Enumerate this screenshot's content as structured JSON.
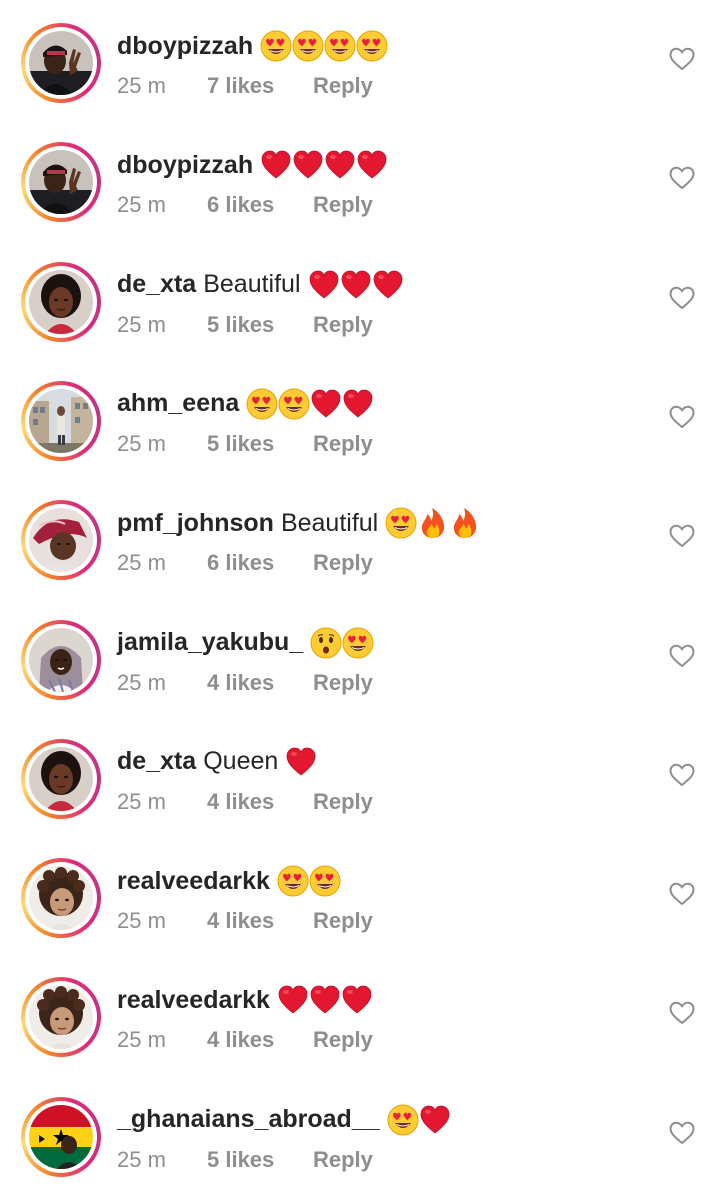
{
  "comments": [
    {
      "username": "dboypizzah",
      "text": "",
      "emojis": [
        "heart-eyes-emoji",
        "heart-eyes-emoji",
        "heart-eyes-emoji",
        "heart-eyes-emoji"
      ],
      "time": "25 m",
      "likes": "7 likes",
      "reply": "Reply",
      "avatar": "man-peace-sign"
    },
    {
      "username": "dboypizzah",
      "text": "",
      "emojis": [
        "red-heart-emoji",
        "red-heart-emoji",
        "red-heart-emoji",
        "red-heart-emoji"
      ],
      "time": "25 m",
      "likes": "6 likes",
      "reply": "Reply",
      "avatar": "man-peace-sign"
    },
    {
      "username": "de_xta",
      "text": "Beautiful",
      "emojis": [
        "red-heart-emoji",
        "red-heart-emoji",
        "red-heart-emoji"
      ],
      "time": "25 m",
      "likes": "5 likes",
      "reply": "Reply",
      "avatar": "woman-portrait"
    },
    {
      "username": "ahm_eena",
      "text": "",
      "emojis": [
        "heart-eyes-emoji",
        "heart-eyes-emoji",
        "red-heart-emoji",
        "red-heart-emoji"
      ],
      "time": "25 m",
      "likes": "5 likes",
      "reply": "Reply",
      "avatar": "building-scene"
    },
    {
      "username": "pmf_johnson",
      "text": "Beautiful",
      "emojis": [
        "heart-eyes-emoji",
        "fire-emoji",
        "fire-emoji"
      ],
      "time": "25 m",
      "likes": "6 likes",
      "reply": "Reply",
      "avatar": "person-red-scarf"
    },
    {
      "username": "jamila_yakubu_",
      "text": "",
      "emojis": [
        "hushed-face-emoji",
        "heart-eyes-emoji"
      ],
      "time": "25 m",
      "likes": "4 likes",
      "reply": "Reply",
      "avatar": "woman-hijab"
    },
    {
      "username": "de_xta",
      "text": "Queen",
      "emojis": [
        "red-heart-emoji"
      ],
      "time": "25 m",
      "likes": "4 likes",
      "reply": "Reply",
      "avatar": "woman-portrait"
    },
    {
      "username": "realveedarkk",
      "text": "",
      "emojis": [
        "heart-eyes-emoji",
        "heart-eyes-emoji"
      ],
      "time": "25 m",
      "likes": "4 likes",
      "reply": "Reply",
      "avatar": "curly-child"
    },
    {
      "username": "realveedarkk",
      "text": "",
      "emojis": [
        "red-heart-emoji",
        "red-heart-emoji",
        "red-heart-emoji"
      ],
      "time": "25 m",
      "likes": "4 likes",
      "reply": "Reply",
      "avatar": "curly-child"
    },
    {
      "username": "_ghanaians_abroad__",
      "text": "",
      "emojis": [
        "heart-eyes-emoji",
        "red-heart-emoji"
      ],
      "time": "25 m",
      "likes": "5 likes",
      "reply": "Reply",
      "avatar": "ghana-flag"
    }
  ],
  "icons": {
    "like": "heart-outline-icon"
  },
  "colors": {
    "text": "#262626",
    "meta": "#8e8e8e",
    "heart": "#e0245e",
    "ring_start": "#f58529",
    "ring_end": "#c13584"
  }
}
